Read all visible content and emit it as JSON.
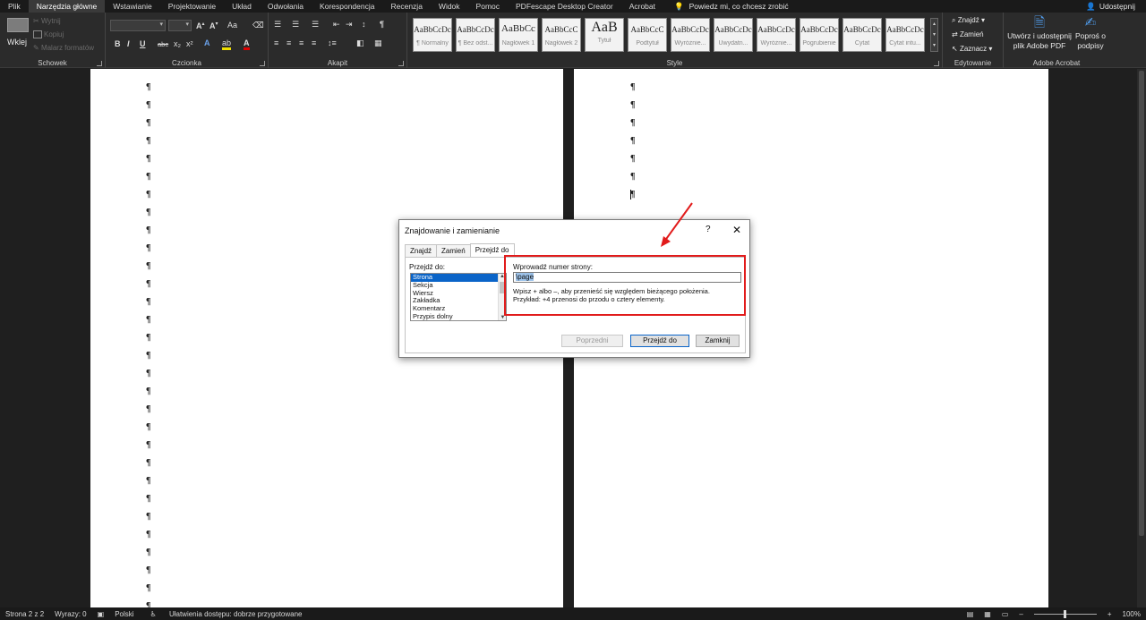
{
  "menu": {
    "tabs": [
      "Plik",
      "Narzędzia główne",
      "Wstawianie",
      "Projektowanie",
      "Układ",
      "Odwołania",
      "Korespondencja",
      "Recenzja",
      "Widok",
      "Pomoc",
      "PDFescape Desktop Creator",
      "Acrobat"
    ],
    "active_tab": "Narzędzia główne",
    "tell_me": "Powiedz mi, co chcesz zrobić",
    "share": "Udostępnij"
  },
  "ribbon": {
    "clipboard": {
      "label": "Schowek",
      "paste": "Wklej",
      "cut": "Wytnij",
      "copy": "Kopiuj",
      "format_painter": "Malarz formatów"
    },
    "font": {
      "label": "Czcionka",
      "bold": "B",
      "italic": "I",
      "underline": "U",
      "strike": "abc"
    },
    "paragraph": {
      "label": "Akapit"
    },
    "styles": {
      "label": "Style",
      "items": [
        {
          "preview": "AaBbCcDc",
          "name": "¶ Normalny"
        },
        {
          "preview": "AaBbCcDc",
          "name": "¶ Bez odst..."
        },
        {
          "preview": "AaBbCc",
          "name": "Nagłówek 1"
        },
        {
          "preview": "AaBbCcC",
          "name": "Nagłówek 2"
        },
        {
          "preview": "AaB",
          "name": "Tytuł"
        },
        {
          "preview": "AaBbCcC",
          "name": "Podtytuł"
        },
        {
          "preview": "AaBbCcDc",
          "name": "Wyróżnie..."
        },
        {
          "preview": "AaBbCcDc",
          "name": "Uwydatn..."
        },
        {
          "preview": "AaBbCcDc",
          "name": "Wyróżnie..."
        },
        {
          "preview": "AaBbCcDc",
          "name": "Pogrubienie"
        },
        {
          "preview": "AaBbCcDc",
          "name": "Cytat"
        },
        {
          "preview": "AaBbCcDc",
          "name": "Cytat intu..."
        }
      ]
    },
    "editing": {
      "label": "Edytowanie",
      "find": "Znajdź",
      "replace": "Zamień",
      "select": "Zaznacz"
    },
    "acrobat": {
      "label": "Adobe Acrobat",
      "create_line1": "Utwórz i udostępnij",
      "create_line2": "plik Adobe PDF",
      "sign_line1": "Poproś o",
      "sign_line2": "podpisy"
    }
  },
  "dialog": {
    "title": "Znajdowanie i zamienianie",
    "help": "?",
    "close": "✕",
    "tabs": [
      "Znajdź",
      "Zamień",
      "Przejdź do"
    ],
    "active_tab": "Przejdź do",
    "goto_label": "Przejdź do:",
    "goto_items": [
      "Strona",
      "Sekcja",
      "Wiersz",
      "Zakładka",
      "Komentarz",
      "Przypis dolny"
    ],
    "selected_item": "Strona",
    "enter_label": "Wprowadź numer strony:",
    "input_value": "\\page",
    "hint_line1": "Wpisz + albo –, aby przenieść się względem bieżącego położenia.",
    "hint_line2": "Przykład: +4 przenosi do przodu o cztery elementy.",
    "buttons": {
      "previous": "Poprzedni",
      "goto": "Przejdź do",
      "close": "Zamknij"
    }
  },
  "status": {
    "page": "Strona 2 z 2",
    "words": "Wyrazy: 0",
    "language": "Polski",
    "accessibility": "Ułatwienia dostępu: dobrze przygotowane",
    "zoom": "100%"
  },
  "document": {
    "pilcrow": "¶"
  },
  "colors": {
    "highlight": "#e11b1b",
    "selection": "#0a64c8",
    "ribbon": "#2b2b2b"
  }
}
